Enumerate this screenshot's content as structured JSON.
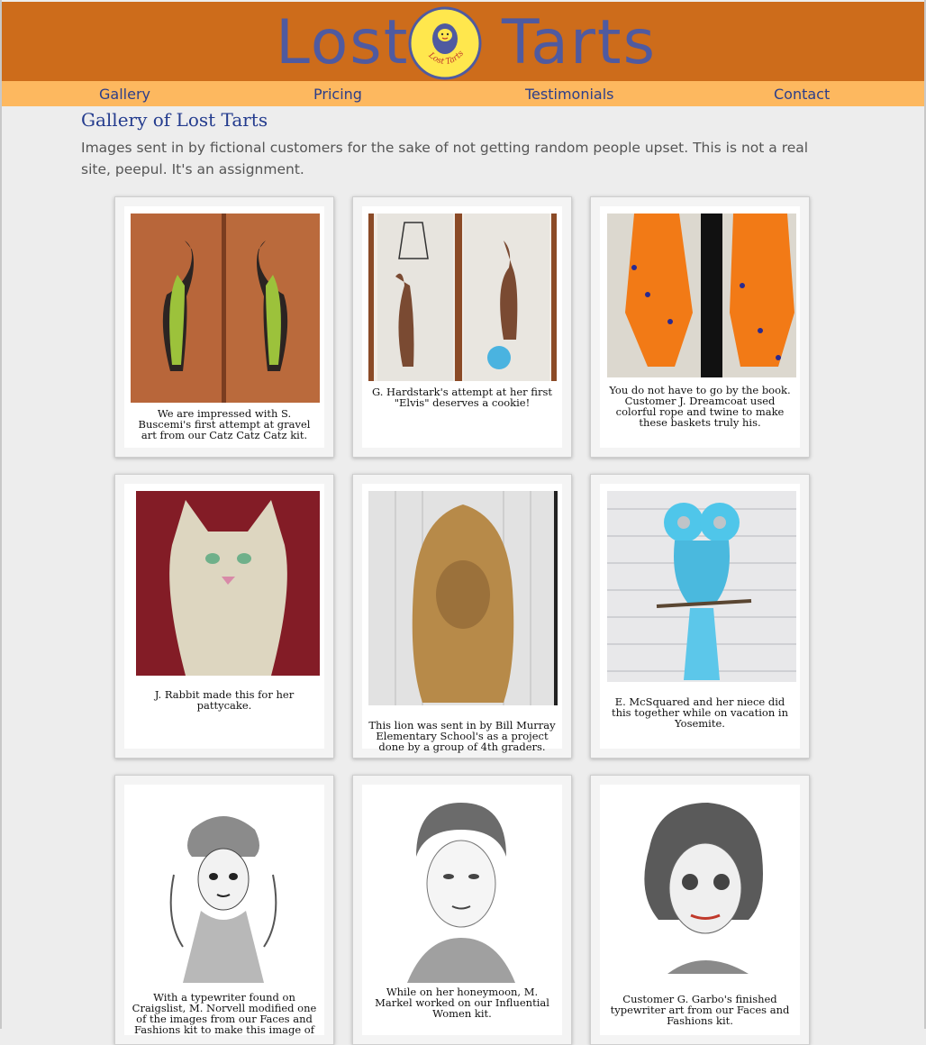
{
  "site": {
    "logo_word_1": "Lost",
    "logo_word_2": "Tarts",
    "badge_text": "Lost Tarts"
  },
  "nav": {
    "items": [
      {
        "label": "Gallery"
      },
      {
        "label": "Pricing"
      },
      {
        "label": "Testimonials"
      },
      {
        "label": "Contact"
      }
    ]
  },
  "main": {
    "title": "Gallery of Lost Tarts",
    "intro": "Images sent in by fictional customers for the sake of not getting random people upset. This is not a real site, peepul. It's an assignment."
  },
  "gallery": {
    "items": [
      {
        "caption": "We are impressed with S. Buscemi's first attempt at gravel art from our Catz Catz Catz kit."
      },
      {
        "caption": "G. Hardstark's attempt at her first \"Elvis\" deserves a cookie!"
      },
      {
        "caption": "You do not have to go by the book. Customer J. Dreamcoat used colorful rope and twine to make these baskets truly his."
      },
      {
        "caption": "J. Rabbit made this for her pattycake."
      },
      {
        "caption": "This lion was sent in by Bill Murray Elementary School's as a project done by a group of 4th graders."
      },
      {
        "caption": "E. McSquared and her niece did this together while on vacation in Yosemite."
      },
      {
        "caption": "With a typewriter found on Craigslist, M. Norvell modified one of the images from our Faces and Fashions kit to make this image of"
      },
      {
        "caption": "While on her honeymoon, M. Markel worked on our Influential Women kit."
      },
      {
        "caption": "Customer G. Garbo's finished typewriter art from our Faces and Fashions kit."
      }
    ]
  },
  "colors": {
    "header_bg": "#cd6c1b",
    "nav_bg": "#fdb85f",
    "logo_text": "#4f5aa0",
    "badge_fill": "#ffe74d",
    "title_text": "#243c8e",
    "page_bg": "#ededed"
  }
}
